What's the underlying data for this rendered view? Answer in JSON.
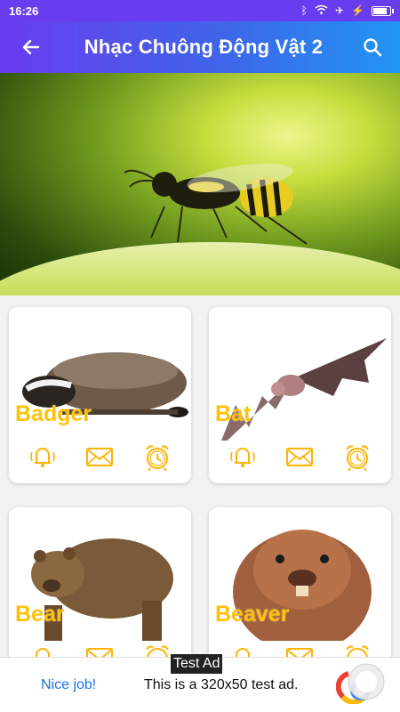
{
  "status": {
    "time": "16:26",
    "battery_level": 0.9
  },
  "appbar": {
    "title": "Nhạc Chuông Động Vật 2",
    "back_icon": "arrow-left-icon",
    "search_icon": "search-icon"
  },
  "colors": {
    "accent": "#ffc107",
    "appbar_start": "#6a3cf0",
    "appbar_end": "#2196f3",
    "ad_link": "#1a73e8"
  },
  "animals": [
    {
      "name": "Badger"
    },
    {
      "name": "Bat"
    },
    {
      "name": "Bear"
    },
    {
      "name": "Beaver"
    }
  ],
  "card_actions": [
    "bell-icon",
    "envelope-icon",
    "alarm-clock-icon"
  ],
  "ad": {
    "tag": "Test Ad",
    "cta": "Nice job!",
    "message": "This is a 320x50 test ad."
  }
}
